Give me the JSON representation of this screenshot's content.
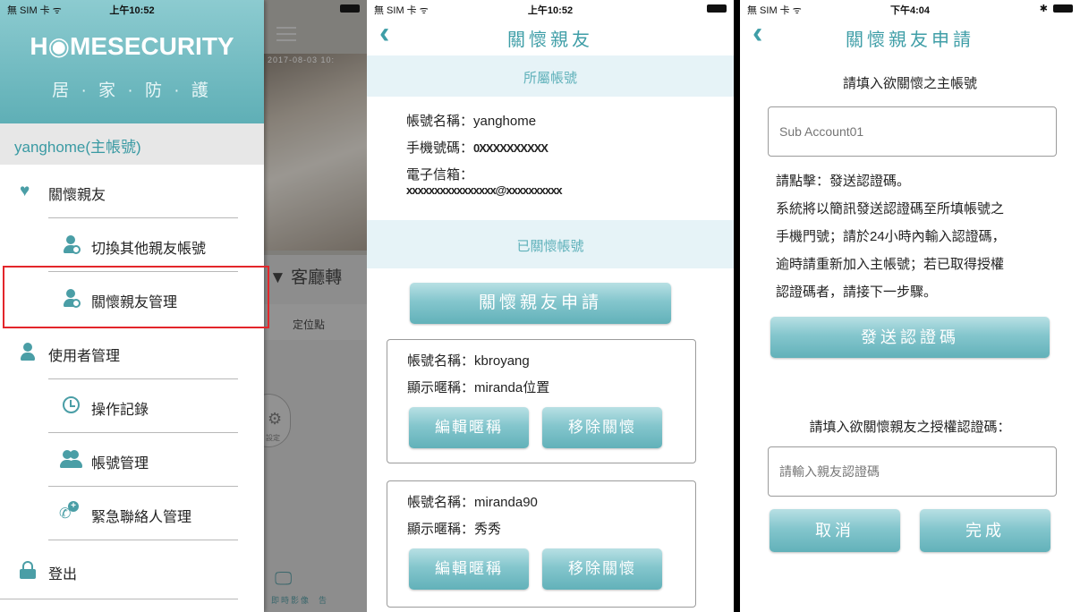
{
  "panel1": {
    "status": {
      "carrier": "無 SIM 卡 ᯤ",
      "time": "上午10:52"
    },
    "logo": "H◉MESECURITY",
    "subtitle": "居 · 家 · 防 · 護",
    "account": "yanghome(主帳號)",
    "menu": [
      {
        "label": "關懷親友",
        "icon": "heart-icon"
      },
      {
        "label": "切換其他親友帳號",
        "icon": "user-switch-icon"
      },
      {
        "label": "關懷親友管理",
        "icon": "user-settings-icon"
      },
      {
        "label": "使用者管理",
        "icon": "user-icon"
      },
      {
        "label": "操作記錄",
        "icon": "clock-icon"
      },
      {
        "label": "帳號管理",
        "icon": "group-icon"
      },
      {
        "label": "緊急聯絡人管理",
        "icon": "phone-add-icon"
      },
      {
        "label": "登出",
        "icon": "lock-icon"
      }
    ],
    "background": {
      "date": "2017-08-03 10:",
      "room": "▼ 客廳轉",
      "location": "定位點",
      "settings": "設定",
      "live": "即時影像",
      "live_suffix": "告"
    },
    "highlight_color": "#e3262b"
  },
  "panel2": {
    "status": {
      "carrier": "無 SIM 卡 ᯤ",
      "time": "上午10:52"
    },
    "title": "關懷親友",
    "section_owner": "所屬帳號",
    "account_name_label": "帳號名稱：",
    "account_name": "yanghome",
    "phone_label": "手機號碼：",
    "phone_mask": "0XXXXXXXXXX",
    "email_label": "電子信箱：",
    "email_mask": "xxxxxxxxxxxxxxxx@xxxxxxxxxx",
    "section_cared": "已關懷帳號",
    "apply_button": "關懷親友申請",
    "cards": [
      {
        "name_label": "帳號名稱：",
        "name": "kbroyang",
        "nick_label": "顯示暱稱：",
        "nick": "miranda位置",
        "edit": "編輯暱稱",
        "remove": "移除關懷"
      },
      {
        "name_label": "帳號名稱：",
        "name": "miranda90",
        "nick_label": "顯示暱稱：",
        "nick": "秀秀",
        "edit": "編輯暱稱",
        "remove": "移除關懷"
      }
    ]
  },
  "panel3": {
    "status": {
      "carrier": "無 SIM 卡 ᯤ",
      "time": "下午4:04",
      "bt": "✱"
    },
    "title": "關懷親友申請",
    "prompt_account": "請填入欲關懷之主帳號",
    "account_placeholder": "Sub Account01",
    "instructions": [
      "請點擊：發送認證碼。",
      "系統將以簡訊發送認證碼至所填帳號之",
      "手機門號；請於24小時內輸入認證碼，",
      "逾時請重新加入主帳號；若已取得授權",
      "認證碼者，請接下一步驟。"
    ],
    "send_button": "發送認證碼",
    "prompt_code": "請填入欲關懷親友之授權認證碼：",
    "code_placeholder": "請輸入親友認證碼",
    "cancel_button": "取消",
    "done_button": "完成"
  },
  "colors": {
    "accent": "#3f9ea7",
    "band": "#e6f3f7",
    "button": "#84c6cd"
  }
}
